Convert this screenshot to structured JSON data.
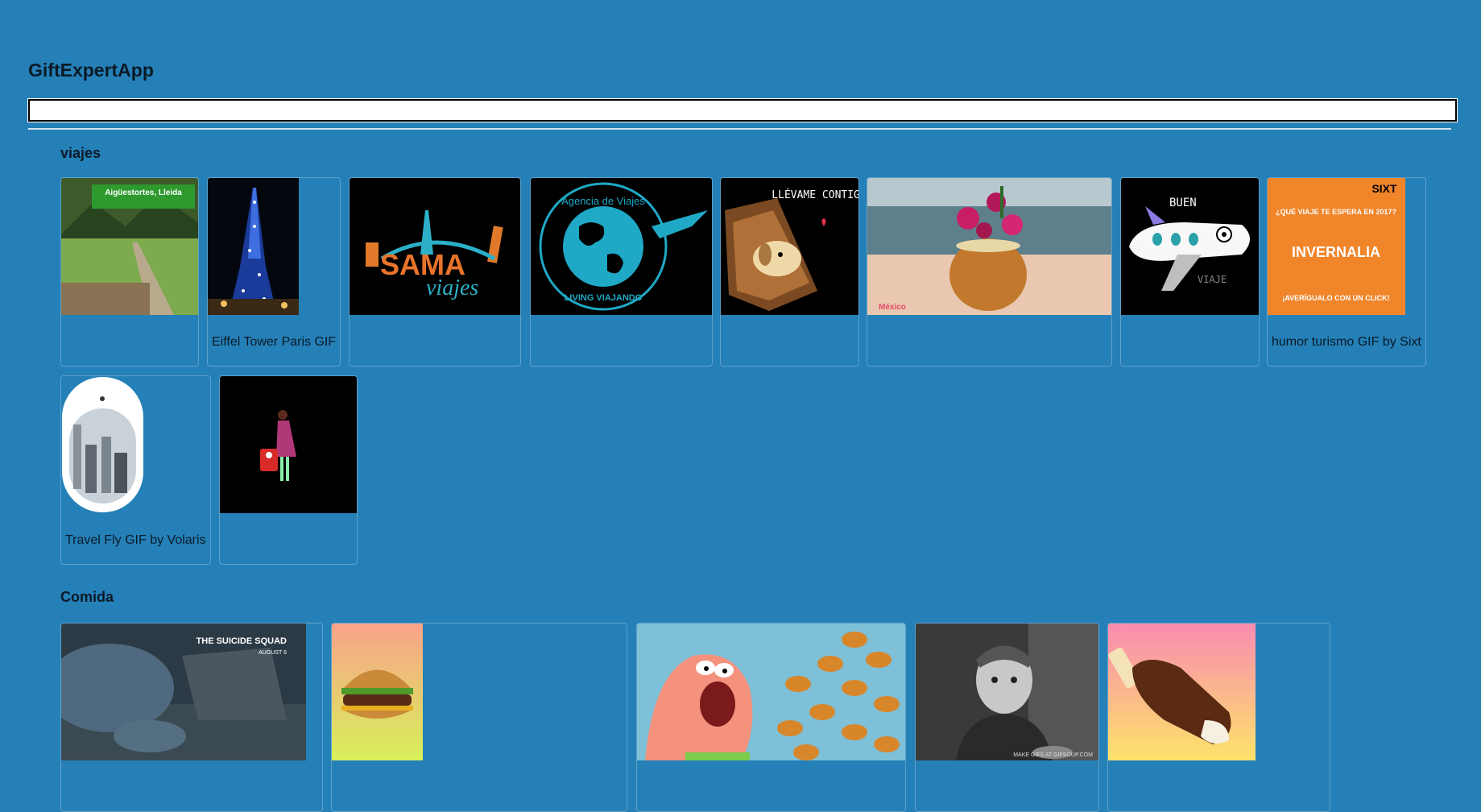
{
  "app": {
    "title": "GiftExpertApp"
  },
  "search": {
    "value": "",
    "placeholder": ""
  },
  "categories": [
    {
      "name": "viajes",
      "gifs": [
        {
          "title": "",
          "art": "landscape",
          "caption": "Aigüestortes, Lleida"
        },
        {
          "title": "Eiffel Tower Paris GIF",
          "art": "eiffel"
        },
        {
          "title": "",
          "art": "sama",
          "logo_text": "SAMA",
          "logo_sub": "viajes"
        },
        {
          "title": "",
          "art": "agency",
          "ring_top": "Agencia de Viajes",
          "ring_bottom": "LIVING VIAJANDO"
        },
        {
          "title": "",
          "art": "suitcase",
          "caption": "LLÉVAME CONTIGO"
        },
        {
          "title": "",
          "art": "coconut",
          "caption": "México"
        },
        {
          "title": "",
          "art": "plane",
          "caption_top": "BUEN",
          "caption_bottom": "VIAJE"
        },
        {
          "title": "humor turismo GIF by Sixt",
          "art": "sixt",
          "brand": "SIXT",
          "line1": "¿QUÉ VIAJE TE ESPERA EN 2017?",
          "line2": "INVERNALIA",
          "line3": "¡AVERÍGUALO CON UN CLICK!"
        },
        {
          "title": "Travel Fly GIF by Volaris",
          "art": "window"
        },
        {
          "title": "",
          "art": "traveler"
        }
      ]
    },
    {
      "name": "Comida",
      "gifs": [
        {
          "title": "",
          "art": "shark",
          "caption": "THE SUICIDE SQUAD",
          "caption_sub": "AUGUST 6"
        },
        {
          "title": "",
          "art": "burger"
        },
        {
          "title": "",
          "art": "patrick"
        },
        {
          "title": "",
          "art": "boy",
          "caption": "MAKE GIFS AT GIFSOUP.COM"
        },
        {
          "title": "",
          "art": "icecream"
        }
      ]
    }
  ],
  "colors": {
    "background": "#2580b8",
    "card_border": "#5fa0c8",
    "text": "#0a1a26"
  }
}
